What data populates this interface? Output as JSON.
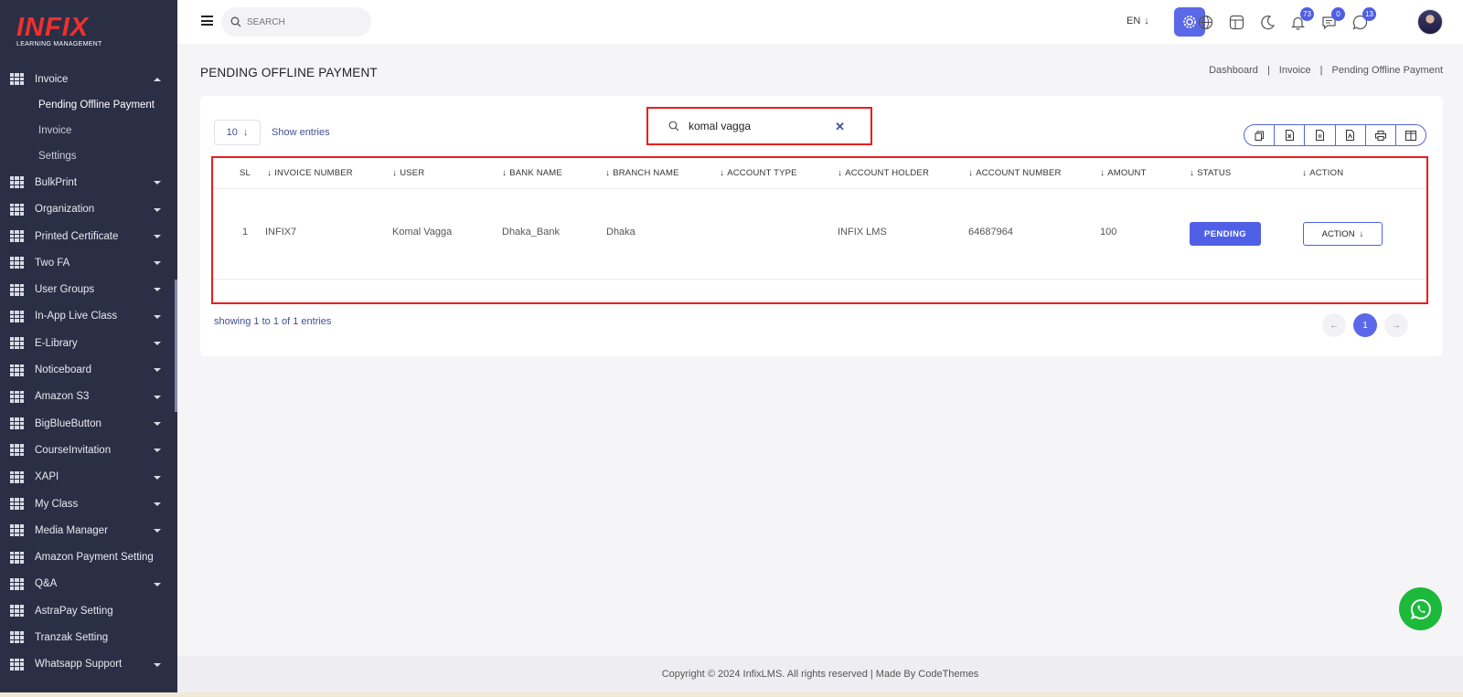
{
  "brand": {
    "name": "INFIX",
    "tagline": "LEARNING MANAGEMENT"
  },
  "sidebar": {
    "items": [
      {
        "label": "Invoice",
        "expanded": true,
        "sub": [
          "Pending Offline Payment",
          "Invoice",
          "Settings"
        ],
        "active_sub": "Pending Offline Payment"
      },
      {
        "label": "BulkPrint"
      },
      {
        "label": "Organization"
      },
      {
        "label": "Printed Certificate"
      },
      {
        "label": "Two FA"
      },
      {
        "label": "User Groups"
      },
      {
        "label": "In-App Live Class"
      },
      {
        "label": "E-Library"
      },
      {
        "label": "Noticeboard"
      },
      {
        "label": "Amazon S3"
      },
      {
        "label": "BigBlueButton"
      },
      {
        "label": "CourseInvitation"
      },
      {
        "label": "XAPI"
      },
      {
        "label": "My Class"
      },
      {
        "label": "Media Manager"
      },
      {
        "label": "Amazon Payment Setting"
      },
      {
        "label": "Q&A"
      },
      {
        "label": "AstraPay Setting"
      },
      {
        "label": "Tranzak Setting"
      },
      {
        "label": "Whatsapp Support"
      }
    ]
  },
  "topbar": {
    "search_placeholder": "SEARCH",
    "language": "EN",
    "notifications_count": "73",
    "messages_count": "0",
    "chat_count": "13"
  },
  "page": {
    "title": "PENDING OFFLINE PAYMENT",
    "breadcrumb": [
      "Dashboard",
      "Invoice",
      "Pending Offline Payment"
    ]
  },
  "table": {
    "entries_value": "10",
    "entries_label": "Show entries",
    "search_value": "komal vagga",
    "columns": [
      "SL",
      "INVOICE NUMBER",
      "USER",
      "BANK NAME",
      "BRANCH NAME",
      "ACCOUNT TYPE",
      "ACCOUNT HOLDER",
      "ACCOUNT NUMBER",
      "AMOUNT",
      "STATUS",
      "ACTION"
    ],
    "rows": [
      {
        "sl": "1",
        "invoice": "INFIX7",
        "user": "Komal Vagga",
        "bank": "Dhaka_Bank",
        "branch": "Dhaka",
        "account_type": "",
        "holder": "INFIX LMS",
        "account_number": "64687964",
        "amount": "100",
        "status": "PENDING",
        "action": "ACTION"
      }
    ],
    "showing_text": "showing 1 to 1 of 1 entries",
    "current_page": "1"
  },
  "footer": {
    "text": "Copyright © 2024 InfixLMS. All rights reserved | Made By CodeThemes"
  },
  "colors": {
    "sidebar_bg": "#2b2f45",
    "accent": "#5b69e8",
    "highlight": "#ee1c1c",
    "whatsapp": "#1cb93a"
  }
}
